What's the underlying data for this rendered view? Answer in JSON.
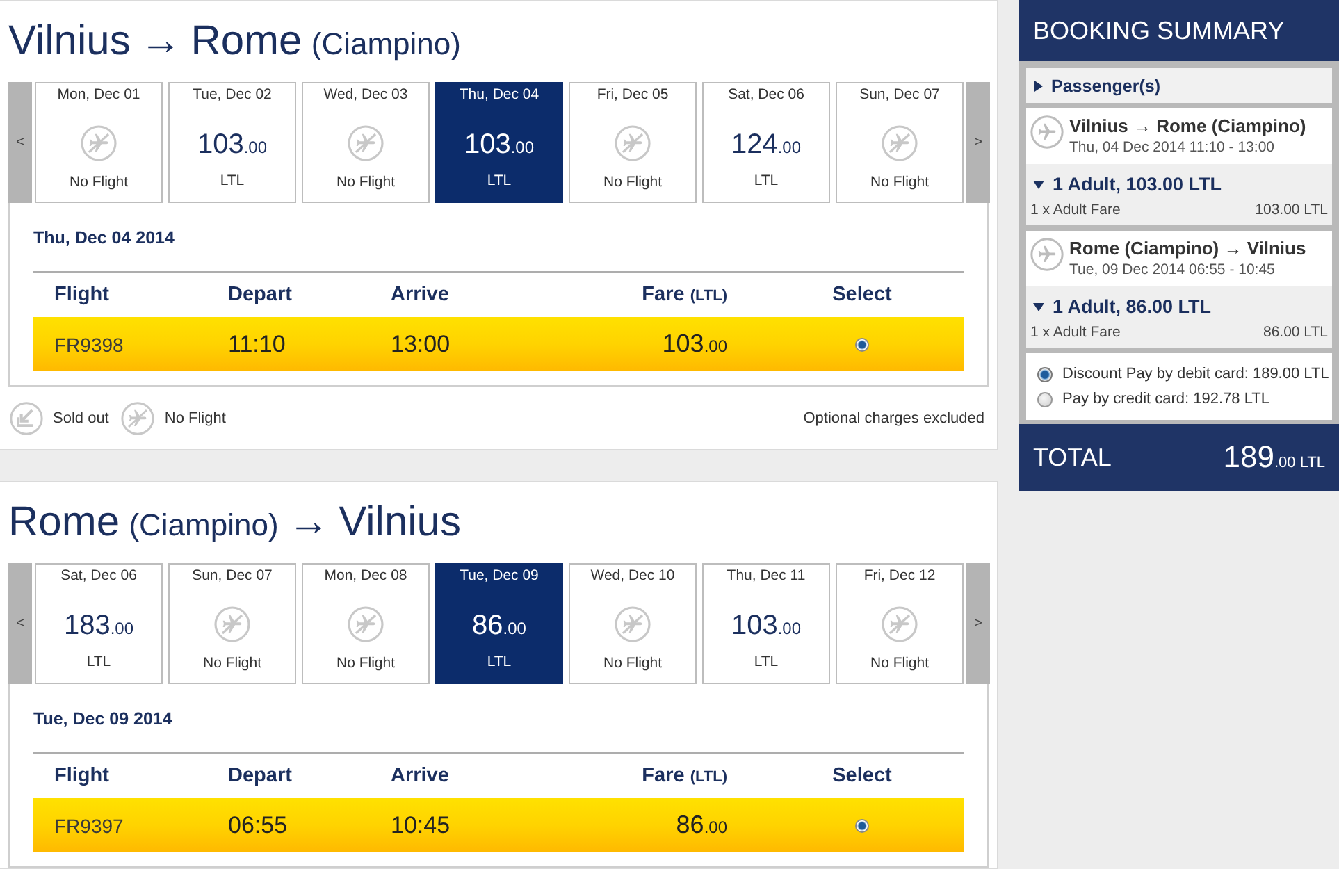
{
  "journeys": [
    {
      "title": [
        {
          "kind": "city",
          "text": "Vilnius"
        },
        {
          "kind": "arrow",
          "text": "→"
        },
        {
          "kind": "city",
          "text": "Rome"
        },
        {
          "kind": "note",
          "text": "(Ciampino)"
        }
      ],
      "prev": "<",
      "next": ">",
      "dates": [
        {
          "kind": "no_flight",
          "date": "Mon, Dec 01",
          "label": "No Flight",
          "selected": false
        },
        {
          "kind": "fare",
          "date": "Tue, Dec 02",
          "price": "103",
          "decimals": ".00",
          "currency": "LTL",
          "selected": false
        },
        {
          "kind": "no_flight",
          "date": "Wed, Dec 03",
          "label": "No Flight",
          "selected": false
        },
        {
          "kind": "fare",
          "date": "Thu, Dec 04",
          "price": "103",
          "decimals": ".00",
          "currency": "LTL",
          "selected": true
        },
        {
          "kind": "no_flight",
          "date": "Fri, Dec 05",
          "label": "No Flight",
          "selected": false
        },
        {
          "kind": "fare",
          "date": "Sat, Dec 06",
          "price": "124",
          "decimals": ".00",
          "currency": "LTL",
          "selected": false
        },
        {
          "kind": "no_flight",
          "date": "Sun, Dec 07",
          "label": "No Flight",
          "selected": false
        }
      ],
      "day_heading": "Thu, Dec 04 2014",
      "columns": [
        {
          "label": "Flight"
        },
        {
          "label": "Depart"
        },
        {
          "label": "Arrive"
        },
        {
          "label": "Fare",
          "unit": "(LTL)"
        },
        {
          "label": "Select"
        }
      ],
      "rows": [
        {
          "flight": "FR9398",
          "depart": "11:10",
          "arrive": "13:00",
          "fare": "103",
          "fare_decimals": ".00",
          "selected": true
        }
      ],
      "legend": [
        {
          "kind": "sold_out",
          "label": "Sold out"
        },
        {
          "kind": "no_flight",
          "label": "No Flight"
        }
      ],
      "note": "Optional charges excluded"
    },
    {
      "title": [
        {
          "kind": "city",
          "text": "Rome"
        },
        {
          "kind": "note",
          "text": "(Ciampino)"
        },
        {
          "kind": "arrow",
          "text": "→"
        },
        {
          "kind": "city",
          "text": "Vilnius"
        }
      ],
      "prev": "<",
      "next": ">",
      "dates": [
        {
          "kind": "fare",
          "date": "Sat, Dec 06",
          "price": "183",
          "decimals": ".00",
          "currency": "LTL",
          "selected": false
        },
        {
          "kind": "no_flight",
          "date": "Sun, Dec 07",
          "label": "No Flight",
          "selected": false
        },
        {
          "kind": "no_flight",
          "date": "Mon, Dec 08",
          "label": "No Flight",
          "selected": false
        },
        {
          "kind": "fare",
          "date": "Tue, Dec 09",
          "price": "86",
          "decimals": ".00",
          "currency": "LTL",
          "selected": true
        },
        {
          "kind": "no_flight",
          "date": "Wed, Dec 10",
          "label": "No Flight",
          "selected": false
        },
        {
          "kind": "fare",
          "date": "Thu, Dec 11",
          "price": "103",
          "decimals": ".00",
          "currency": "LTL",
          "selected": false
        },
        {
          "kind": "no_flight",
          "date": "Fri, Dec 12",
          "label": "No Flight",
          "selected": false
        }
      ],
      "day_heading": "Tue, Dec 09 2014",
      "columns": [
        {
          "label": "Flight"
        },
        {
          "label": "Depart"
        },
        {
          "label": "Arrive"
        },
        {
          "label": "Fare",
          "unit": "(LTL)"
        },
        {
          "label": "Select"
        }
      ],
      "rows": [
        {
          "flight": "FR9397",
          "depart": "06:55",
          "arrive": "10:45",
          "fare": "86",
          "fare_decimals": ".00",
          "selected": true
        }
      ]
    }
  ],
  "summary": {
    "title": "BOOKING SUMMARY",
    "passengers": {
      "label": "Passenger(s)",
      "expanded": false
    },
    "flights": [
      {
        "route": "Vilnius → Rome (Ciampino)",
        "details": "Thu, 04 Dec 2014 11:10 - 13:00",
        "fare": {
          "label": "1 Adult, 103.00 LTL",
          "expanded": true,
          "lines": [
            {
              "label": "1 x Adult Fare",
              "amount": "103.00 LTL"
            }
          ]
        }
      },
      {
        "route": "Rome (Ciampino) → Vilnius",
        "details": "Tue, 09 Dec 2014 06:55 - 10:45",
        "fare": {
          "label": "1 Adult, 86.00 LTL",
          "expanded": true,
          "lines": [
            {
              "label": "1 x Adult Fare",
              "amount": "86.00 LTL"
            }
          ]
        }
      }
    ],
    "payment": [
      {
        "label": "Discount Pay by debit card: 189.00 LTL",
        "selected": true
      },
      {
        "label": "Pay by credit card: 192.78 LTL",
        "selected": false
      }
    ],
    "total": {
      "label": "TOTAL",
      "amount": "189",
      "decimals": ".00",
      "currency": "LTL"
    }
  }
}
